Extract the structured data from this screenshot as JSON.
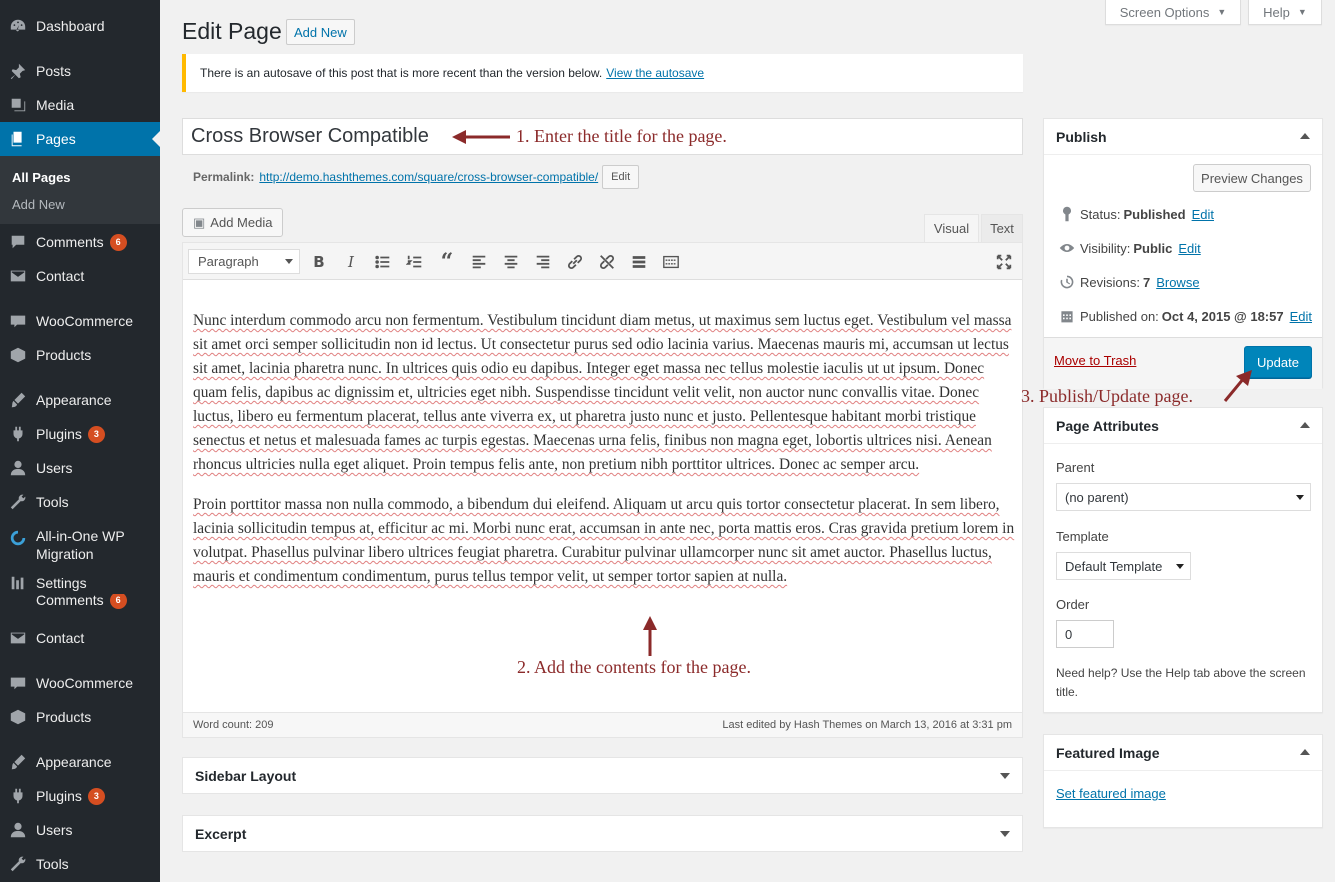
{
  "sidebar": {
    "items": [
      {
        "label": "Dashboard",
        "icon": "dashboard-icon"
      },
      {
        "label": "Posts",
        "icon": "pin-icon"
      },
      {
        "label": "Media",
        "icon": "media-icon"
      },
      {
        "label": "Pages",
        "icon": "pages-icon"
      },
      {
        "label": "Comments",
        "icon": "comments-icon",
        "badge": "6"
      },
      {
        "label": "Contact",
        "icon": "mail-icon"
      },
      {
        "label": "WooCommerce",
        "icon": "woocommerce-icon"
      },
      {
        "label": "Products",
        "icon": "products-icon"
      },
      {
        "label": "Appearance",
        "icon": "brush-icon"
      },
      {
        "label": "Plugins",
        "icon": "plugin-icon",
        "badge": "3"
      },
      {
        "label": "Users",
        "icon": "users-icon"
      },
      {
        "label": "Tools",
        "icon": "wrench-icon"
      },
      {
        "label": "All-in-One WP",
        "label2": "Migration",
        "icon": "migration-icon"
      },
      {
        "label": "Settings",
        "icon": "settings-icon"
      },
      {
        "label": "Comments",
        "icon": "comments-icon",
        "badge": "6"
      },
      {
        "label": "Contact",
        "icon": "mail-icon"
      },
      {
        "label": "WooCommerce",
        "icon": "woocommerce-icon"
      },
      {
        "label": "Products",
        "icon": "products-icon"
      },
      {
        "label": "Appearance",
        "icon": "brush-icon"
      },
      {
        "label": "Plugins",
        "icon": "plugin-icon",
        "badge": "3"
      },
      {
        "label": "Users",
        "icon": "users-icon"
      },
      {
        "label": "Tools",
        "icon": "wrench-icon"
      }
    ],
    "submenu": {
      "all_pages": "All Pages",
      "add_new": "Add New"
    }
  },
  "top": {
    "screen_options": "Screen Options",
    "help": "Help"
  },
  "header": {
    "title": "Edit Page",
    "add_new": "Add New"
  },
  "notice": {
    "text": "There is an autosave of this post that is more recent than the version below.",
    "link": "View the autosave"
  },
  "post": {
    "title": "Cross Browser Compatible",
    "permalink_label": "Permalink:",
    "permalink_url": "http://demo.hashthemes.com/square/cross-browser-compatible/",
    "permalink_edit": "Edit"
  },
  "editor": {
    "add_media": "Add Media",
    "tab_visual": "Visual",
    "tab_text": "Text",
    "format": "Paragraph",
    "paragraph1": "Nunc interdum commodo arcu non fermentum. Vestibulum tincidunt diam metus, ut maximus sem luctus eget. Vestibulum vel massa sit amet orci semper sollicitudin non id lectus. Ut consectetur purus sed odio lacinia varius. Maecenas mauris mi, accumsan ut lectus sit amet, lacinia pharetra nunc. In ultrices quis odio eu dapibus. Integer eget massa nec tellus molestie iaculis ut ut ipsum. Donec quam felis, dapibus ac dignissim et, ultricies eget nibh. Suspendisse tincidunt velit velit, non auctor nunc convallis vitae. Donec luctus, libero eu fermentum placerat, tellus ante viverra ex, ut pharetra justo nunc et justo. Pellentesque habitant morbi tristique senectus et netus et malesuada fames ac turpis egestas. Maecenas urna felis, finibus non magna eget, lobortis ultrices nisi. Aenean rhoncus ultricies nulla eget aliquet. Proin tempus felis ante, non pretium nibh porttitor ultrices. Donec ac semper arcu.",
    "paragraph2": "Proin porttitor massa non nulla commodo, a bibendum dui eleifend. Aliquam ut arcu quis tortor consectetur placerat. In sem libero, lacinia sollicitudin tempus at, efficitur ac mi. Morbi nunc erat, accumsan in ante nec, porta mattis eros. Cras gravida pretium lorem in volutpat. Phasellus pulvinar libero ultrices feugiat pharetra. Curabitur pulvinar ullamcorper nunc sit amet auctor. Phasellus luctus, mauris et condimentum condimentum, purus tellus tempor velit, ut semper tortor sapien at nulla.",
    "word_count": "Word count: 209",
    "last_edited": "Last edited by Hash Themes on March 13, 2016 at 3:31 pm"
  },
  "annotations": {
    "a1": "1. Enter the title for the page.",
    "a2": "2. Add the contents for the page.",
    "a3": "3. Publish/Update page."
  },
  "publish": {
    "title": "Publish",
    "preview": "Preview Changes",
    "status_label": "Status:",
    "status_value": "Published",
    "status_edit": "Edit",
    "visibility_label": "Visibility:",
    "visibility_value": "Public",
    "visibility_edit": "Edit",
    "revisions_label": "Revisions:",
    "revisions_value": "7",
    "revisions_browse": "Browse",
    "published_label": "Published on:",
    "published_value": "Oct 4, 2015 @ 18:57",
    "published_edit": "Edit",
    "trash": "Move to Trash",
    "update": "Update"
  },
  "attributes": {
    "title": "Page Attributes",
    "parent_label": "Parent",
    "parent_value": "(no parent)",
    "template_label": "Template",
    "template_value": "Default Template",
    "order_label": "Order",
    "order_value": "0",
    "help": "Need help? Use the Help tab above the screen title."
  },
  "featured": {
    "title": "Featured Image",
    "link": "Set featured image"
  },
  "boxes": {
    "sidebar_layout": "Sidebar Layout",
    "excerpt": "Excerpt"
  },
  "colors": {
    "accent": "#0073aa",
    "primary_button": "#0085ba",
    "sidebar_bg": "#23282d",
    "annotation": "#8b2a2a",
    "notice": "#ffb900"
  }
}
